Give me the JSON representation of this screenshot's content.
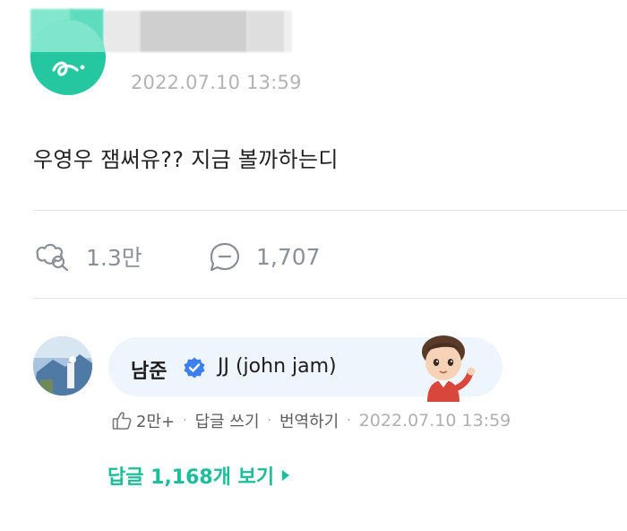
{
  "post": {
    "avatar_icon": "user-avatar-icon",
    "date": "2022.07.10 13:59",
    "text": "우영우 잼써유?? 지금 볼까하는디"
  },
  "stats": {
    "likes": "1.3만",
    "likes_icon": "like-icon",
    "comments": "1,707",
    "comments_icon": "comment-icon"
  },
  "comment": {
    "author": "남준",
    "verified_icon": "verified-check-icon",
    "text": "JJ (john jam)",
    "sticker_icon": "character-sticker-icon",
    "likes": "2만+",
    "reply_label": "답글 쓰기",
    "translate_label": "번역하기",
    "date": "2022.07.10 13:59",
    "view_replies_label": "답글 1,168개 보기"
  },
  "colors": {
    "accent": "#1bbd9a",
    "bubble": "#eef5fd",
    "verified": "#3b7ff5"
  }
}
